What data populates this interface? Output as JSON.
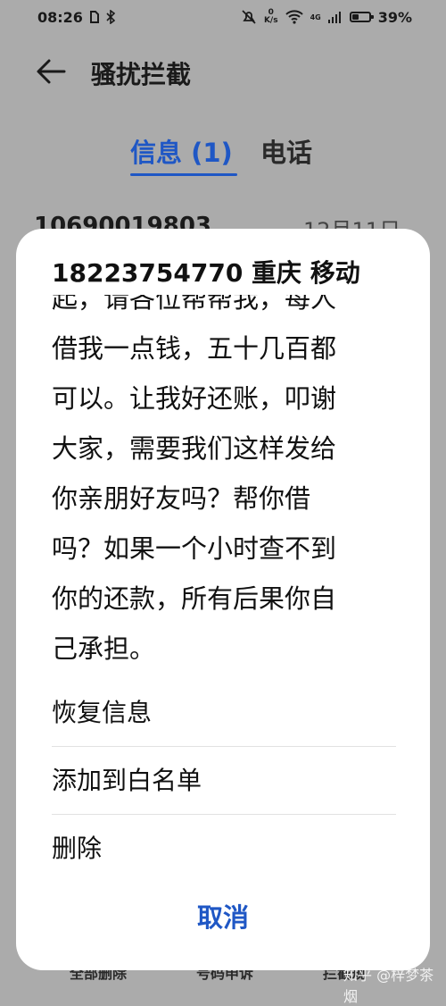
{
  "status_bar": {
    "time": "08:26",
    "net_speed_value": "0",
    "net_speed_unit": "K/s",
    "signal_label": "4G",
    "battery_percent": "39%",
    "battery_level": 0.39
  },
  "header": {
    "title": "骚扰拦截"
  },
  "tabs": [
    {
      "label": "信息 (1)",
      "active": true
    },
    {
      "label": "电话",
      "active": false
    }
  ],
  "background_list": {
    "sender": "10690019803",
    "date": "12月11日"
  },
  "bottom_bar": [
    "全部删除",
    "号码申诉",
    "拦截规"
  ],
  "watermark": "知乎 @梓梦茶烟",
  "sheet": {
    "title": "18223754770 重庆 移动",
    "message_lines": [
      "起，请各位帮帮我，每人",
      "借我一点钱，五十几百都",
      "可以。让我好还账，叩谢",
      "大家，需要我们这样发给",
      "你亲朋好友吗？帮你借",
      "吗？如果一个小时查不到",
      "你的还款，所有后果你自",
      "己承担。"
    ],
    "actions": [
      "恢复信息",
      "添加到白名单",
      "删除"
    ],
    "cancel_label": "取消"
  },
  "colors": {
    "accent": "#1f57c5",
    "dim_background": "#ababab",
    "sheet": "#ffffff"
  }
}
